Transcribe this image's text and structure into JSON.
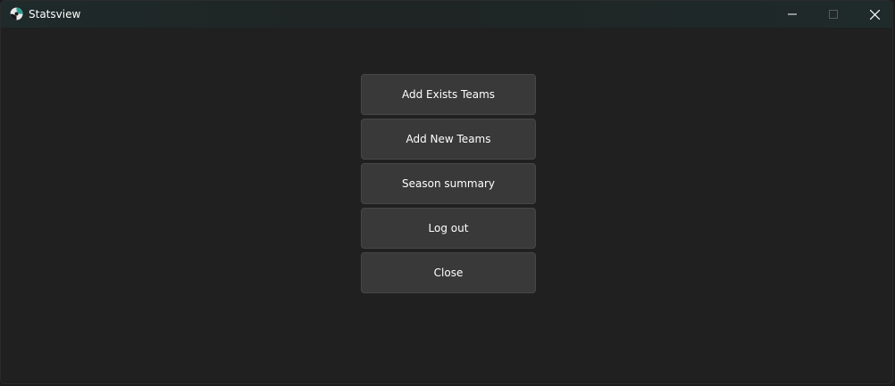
{
  "window": {
    "title": "Statsview",
    "app_icon": "soccer-ball-icon"
  },
  "caption_buttons": {
    "minimize": "minimize-icon",
    "maximize": "maximize-icon",
    "close": "close-icon"
  },
  "menu": {
    "items": [
      {
        "label": "Add Exists Teams"
      },
      {
        "label": "Add New Teams"
      },
      {
        "label": "Season summary"
      },
      {
        "label": "Log out"
      },
      {
        "label": "Close"
      }
    ]
  },
  "colors": {
    "background": "#202020",
    "button": "#393939",
    "button_border": "#474747",
    "text": "#ffffff"
  }
}
